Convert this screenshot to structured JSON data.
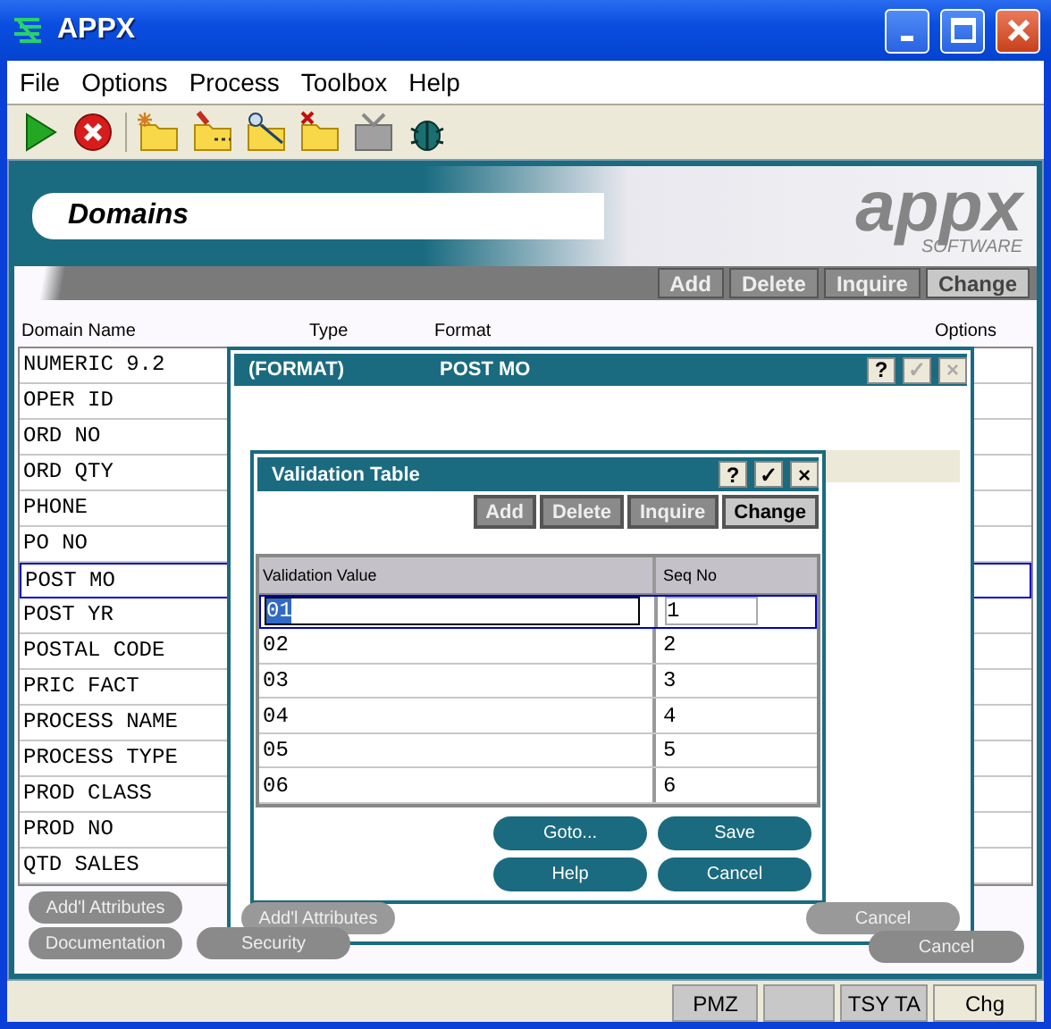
{
  "window": {
    "title": "APPX"
  },
  "menu": [
    "File",
    "Options",
    "Process",
    "Toolbox",
    "Help"
  ],
  "main": {
    "title": "Domains",
    "logo": "appx",
    "logo_sub": "SOFTWARE",
    "buttons": [
      {
        "label": "Add",
        "selected": false
      },
      {
        "label": "Delete",
        "selected": false
      },
      {
        "label": "Inquire",
        "selected": false
      },
      {
        "label": "Change",
        "selected": true
      }
    ],
    "columns": [
      "Domain Name",
      "Type",
      "Format",
      "Options"
    ],
    "rows": [
      {
        "name": "NUMERIC 9.2",
        "selected": false
      },
      {
        "name": "OPER ID",
        "selected": false
      },
      {
        "name": "ORD NO",
        "selected": false
      },
      {
        "name": "ORD QTY",
        "selected": false
      },
      {
        "name": "PHONE",
        "selected": false
      },
      {
        "name": "PO NO",
        "selected": false
      },
      {
        "name": "POST MO",
        "selected": true
      },
      {
        "name": "POST YR",
        "selected": false
      },
      {
        "name": "POSTAL CODE",
        "selected": false
      },
      {
        "name": "PRIC FACT",
        "selected": false
      },
      {
        "name": "PROCESS NAME",
        "selected": false
      },
      {
        "name": "PROCESS TYPE",
        "selected": false
      },
      {
        "name": "PROD CLASS",
        "selected": false
      },
      {
        "name": "PROD NO",
        "selected": false
      },
      {
        "name": "QTD SALES",
        "selected": false
      }
    ],
    "bottom_buttons": [
      "Add'l Attributes",
      "Documentation",
      "Security",
      "Cancel"
    ]
  },
  "format_dialog": {
    "label": "(FORMAT)",
    "value": "POST MO",
    "controls": [
      "?",
      "✓",
      "×"
    ],
    "buttons": [
      "Add'l Attributes",
      "Cancel"
    ]
  },
  "validation_dialog": {
    "title": "Validation Table",
    "controls": [
      "?",
      "✓",
      "×"
    ],
    "buttons": [
      {
        "label": "Add",
        "selected": false
      },
      {
        "label": "Delete",
        "selected": false
      },
      {
        "label": "Inquire",
        "selected": false
      },
      {
        "label": "Change",
        "selected": true
      }
    ],
    "columns": [
      "Validation Value",
      "Seq No"
    ],
    "rows": [
      {
        "value": "01",
        "seq": "1",
        "selected": true
      },
      {
        "value": "02",
        "seq": "2",
        "selected": false
      },
      {
        "value": "03",
        "seq": "3",
        "selected": false
      },
      {
        "value": "04",
        "seq": "4",
        "selected": false
      },
      {
        "value": "05",
        "seq": "5",
        "selected": false
      },
      {
        "value": "06",
        "seq": "6",
        "selected": false
      }
    ],
    "actions": [
      "Goto...",
      "Save",
      "Help",
      "Cancel"
    ]
  },
  "status_bar": [
    "PMZ",
    "TSY TA",
    "Chg"
  ]
}
